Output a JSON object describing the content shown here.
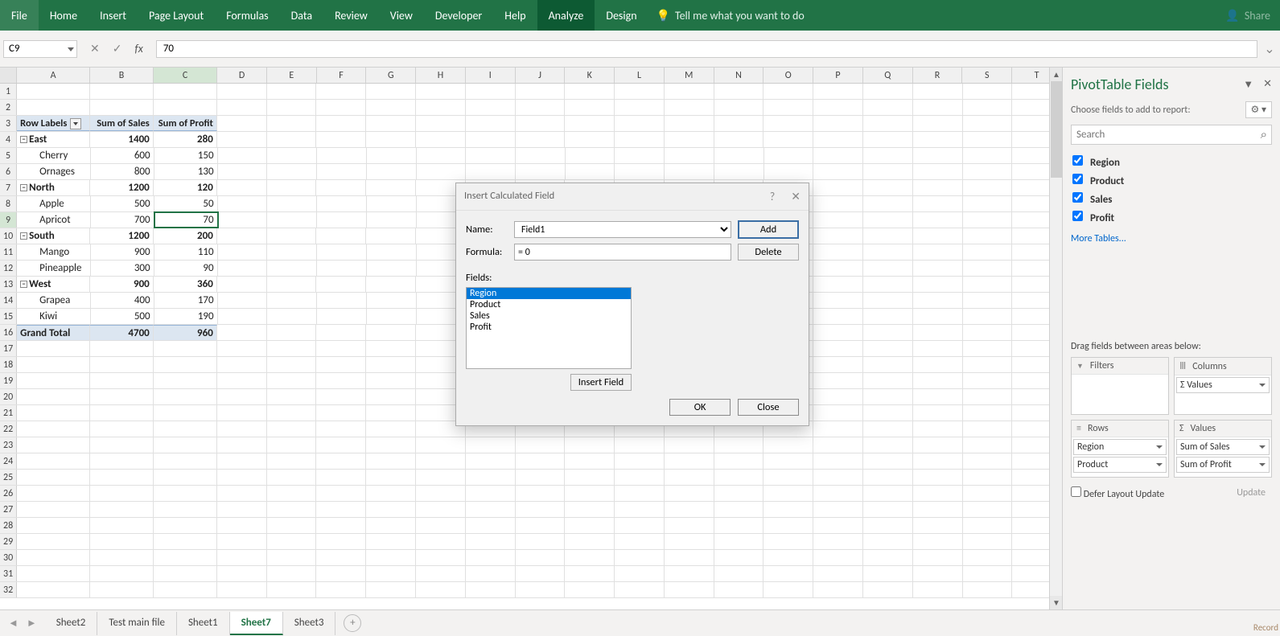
{
  "ribbon": {
    "tabs": [
      "File",
      "Home",
      "Insert",
      "Page Layout",
      "Formulas",
      "Data",
      "Review",
      "View",
      "Developer",
      "Help",
      "Analyze",
      "Design"
    ],
    "active": "Analyze",
    "tell_me": "Tell me what you want to do",
    "share": "Share"
  },
  "formula_bar": {
    "name_box": "C9",
    "value": "70"
  },
  "columns": [
    "A",
    "B",
    "C",
    "D",
    "E",
    "F",
    "G",
    "H",
    "I",
    "J",
    "K",
    "L",
    "M",
    "N",
    "O",
    "P",
    "Q",
    "R",
    "S",
    "T"
  ],
  "pivot_headers": {
    "row_labels": "Row Labels",
    "sum_sales": "Sum of Sales",
    "sum_profit": "Sum of Profit"
  },
  "pivot_data": [
    {
      "type": "group",
      "label": "East",
      "sales": 1400,
      "profit": 280
    },
    {
      "type": "item",
      "label": "Cherry",
      "sales": 600,
      "profit": 150
    },
    {
      "type": "item",
      "label": "Ornages",
      "sales": 800,
      "profit": 130
    },
    {
      "type": "group",
      "label": "North",
      "sales": 1200,
      "profit": 120
    },
    {
      "type": "item",
      "label": "Apple",
      "sales": 500,
      "profit": 50
    },
    {
      "type": "item",
      "label": "Apricot",
      "sales": 700,
      "profit": 70
    },
    {
      "type": "group",
      "label": "South",
      "sales": 1200,
      "profit": 200
    },
    {
      "type": "item",
      "label": "Mango",
      "sales": 900,
      "profit": 110
    },
    {
      "type": "item",
      "label": "Pineapple",
      "sales": 300,
      "profit": 90
    },
    {
      "type": "group",
      "label": "West",
      "sales": 900,
      "profit": 360
    },
    {
      "type": "item",
      "label": "Grapea",
      "sales": 400,
      "profit": 170
    },
    {
      "type": "item",
      "label": "Kiwi",
      "sales": 500,
      "profit": 190
    }
  ],
  "grand_total": {
    "label": "Grand Total",
    "sales": 4700,
    "profit": 960
  },
  "active_cell_row": 9,
  "dialog": {
    "title": "Insert Calculated Field",
    "name_label": "Name:",
    "name_value": "Field1",
    "formula_label": "Formula:",
    "formula_value": "= 0",
    "add": "Add",
    "delete": "Delete",
    "fields_label": "Fields:",
    "fields": [
      "Region",
      "Product",
      "Sales",
      "Profit"
    ],
    "insert_field": "Insert Field",
    "ok": "OK",
    "close": "Close"
  },
  "pane": {
    "title": "PivotTable Fields",
    "subtitle": "Choose fields to add to report:",
    "search_placeholder": "Search",
    "fields": [
      "Region",
      "Product",
      "Sales",
      "Profit"
    ],
    "more": "More Tables...",
    "drag_label": "Drag fields between areas below:",
    "filters": "Filters",
    "columns": "Columns",
    "rows": "Rows",
    "values": "Values",
    "values_item": "Σ Values",
    "rows_items": [
      "Region",
      "Product"
    ],
    "values_items": [
      "Sum of Sales",
      "Sum of Profit"
    ],
    "defer": "Defer Layout Update",
    "update": "Update"
  },
  "sheets": [
    "Sheet2",
    "Test main file",
    "Sheet1",
    "Sheet7",
    "Sheet3"
  ],
  "active_sheet": "Sheet7",
  "status_right": "Record"
}
